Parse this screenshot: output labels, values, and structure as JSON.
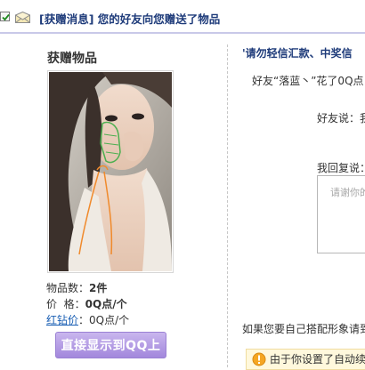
{
  "header": {
    "subject_tag": "[获赠消息]",
    "subject_text": " 您的好友向您赠送了物品"
  },
  "gift": {
    "title": "获赠物品",
    "count_label": "物品数：",
    "count_value": "2件",
    "price_label": "价  格：",
    "price_value": "0Q点/个",
    "diamond_label": "红钻价",
    "diamond_value": "：0Q点/个",
    "show_button": "直接显示到QQ上"
  },
  "message": {
    "warning": "'请勿轻信汇款、中奖信",
    "spent": "好友“落蓝丶”花了0Q点",
    "friend_said": "好友说：我",
    "reply_label": "我回复说：",
    "reply_placeholder": "请谢你的",
    "diy_text": "如果您要自己搭配形象请到",
    "notice": "由于你设置了自动续"
  },
  "colors": {
    "subject": "#1e3b7a",
    "button_top": "#c9b6ee",
    "button_bottom": "#a287dc",
    "notice_bg": "#fff8dc"
  },
  "icons": {
    "checkbox": "checkbox-checked-icon",
    "message": "envelope-icon",
    "notice": "warning-icon"
  }
}
